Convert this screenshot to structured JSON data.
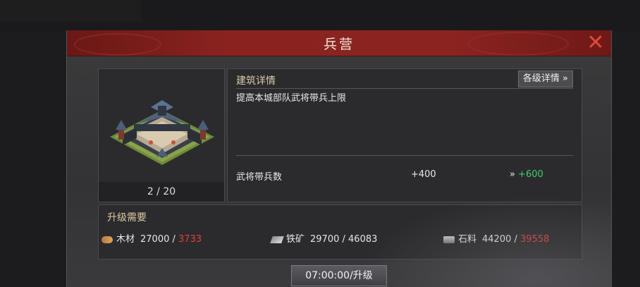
{
  "dialog": {
    "title": "兵营",
    "close_icon": "close-icon"
  },
  "building": {
    "level_text": "2 / 20",
    "image": "barracks-building-image"
  },
  "details": {
    "heading": "建筑详情",
    "levels_button": "各级详情 »",
    "description": "提高本城部队武将带兵上限",
    "stat": {
      "label": "武将带兵数",
      "current": "+400",
      "arrow": "»",
      "next": "+600"
    }
  },
  "requirements": {
    "heading": "升级需要",
    "resources": [
      {
        "icon": "wood-icon",
        "name": "木材",
        "need": "27000",
        "have": "3733"
      },
      {
        "icon": "iron-icon",
        "name": "铁矿",
        "need": "29700",
        "have": "46083"
      },
      {
        "icon": "stone-icon",
        "name": "石料",
        "need": "44200",
        "have": "39558"
      }
    ]
  },
  "upgrade_button": "07:00:00/升级",
  "colors": {
    "title_bar": "#8a2320",
    "accent_gold": "#d9c9a6",
    "bonus_green": "#3fcf6f",
    "shortage_red": "#e2403a"
  }
}
